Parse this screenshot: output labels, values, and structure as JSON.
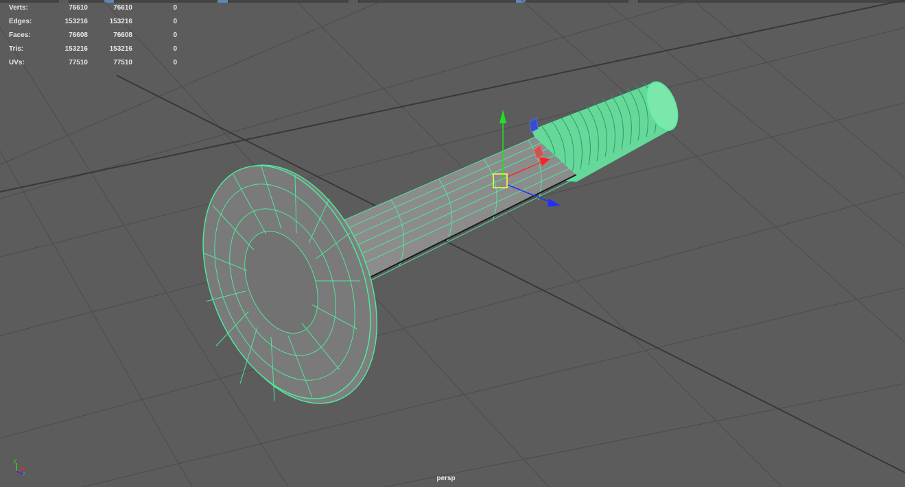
{
  "hud": {
    "rows": [
      {
        "label": "Verts:",
        "v1": "76610",
        "v2": "76610",
        "v3": "0"
      },
      {
        "label": "Edges:",
        "v1": "153216",
        "v2": "153216",
        "v3": "0"
      },
      {
        "label": "Faces:",
        "v1": "76608",
        "v2": "76608",
        "v3": "0"
      },
      {
        "label": "Tris:",
        "v1": "153216",
        "v2": "153216",
        "v3": "0"
      },
      {
        "label": "UVs:",
        "v1": "77510",
        "v2": "77510",
        "v3": "0"
      }
    ]
  },
  "viewport": {
    "camera_label": "persp",
    "axis_labels": {
      "y": "y",
      "z": "z"
    }
  },
  "colors": {
    "background": "#5c5c5c",
    "grid": "#4a4a4a",
    "grid_major": "#333333",
    "wireframe": "#4fe89a",
    "mesh_fill": "#8a8a8a",
    "axis_x": "#ff2020",
    "axis_y": "#20e020",
    "axis_z": "#2030ff",
    "center_handle": "#ffff40"
  },
  "icons": {
    "axis_indicator": "view-axis-icon",
    "move_manipulator": "move-tool-gizmo-icon"
  }
}
